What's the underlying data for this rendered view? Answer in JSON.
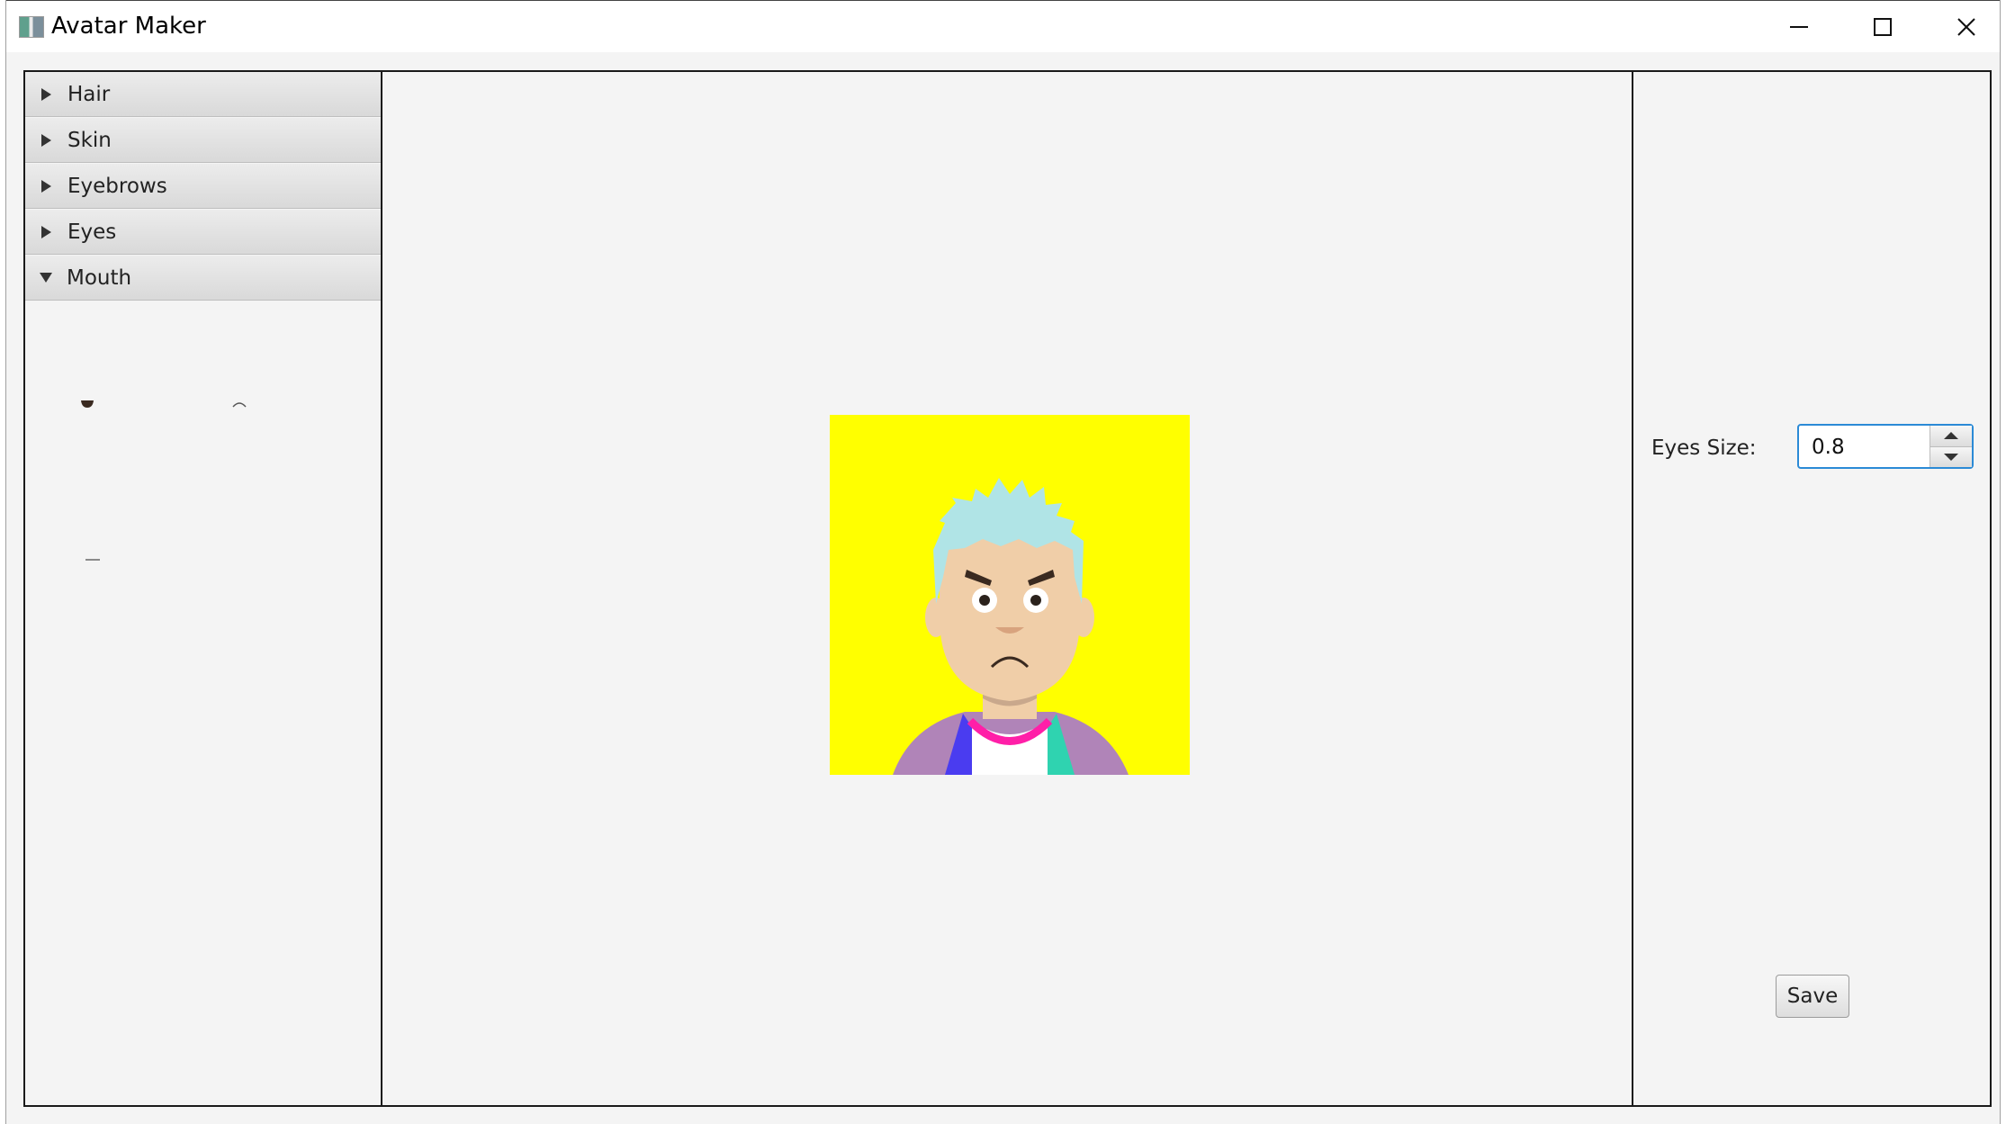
{
  "window": {
    "title": "Avatar Maker",
    "controls": [
      "minimize-icon",
      "maximize-icon",
      "close-icon"
    ]
  },
  "sidebar": {
    "sections": [
      {
        "label": "Hair",
        "expanded": false
      },
      {
        "label": "Skin",
        "expanded": false
      },
      {
        "label": "Eyebrows",
        "expanded": false
      },
      {
        "label": "Eyes",
        "expanded": false
      },
      {
        "label": "Mouth",
        "expanded": true
      }
    ],
    "mouth_options": [
      "open-mouth-icon",
      "frown-mouth-icon",
      "flat-mouth-icon"
    ]
  },
  "preview": {
    "background_color": "#ffff00",
    "hair_color": "#b0e4e6",
    "skin_color": "#f0cea8",
    "jacket_color": "#b084b8",
    "collar_color": "#ff1fa8"
  },
  "controls": {
    "eyes_size_label": "Eyes Size:",
    "eyes_size_value": "0.8",
    "save_label": "Save"
  }
}
